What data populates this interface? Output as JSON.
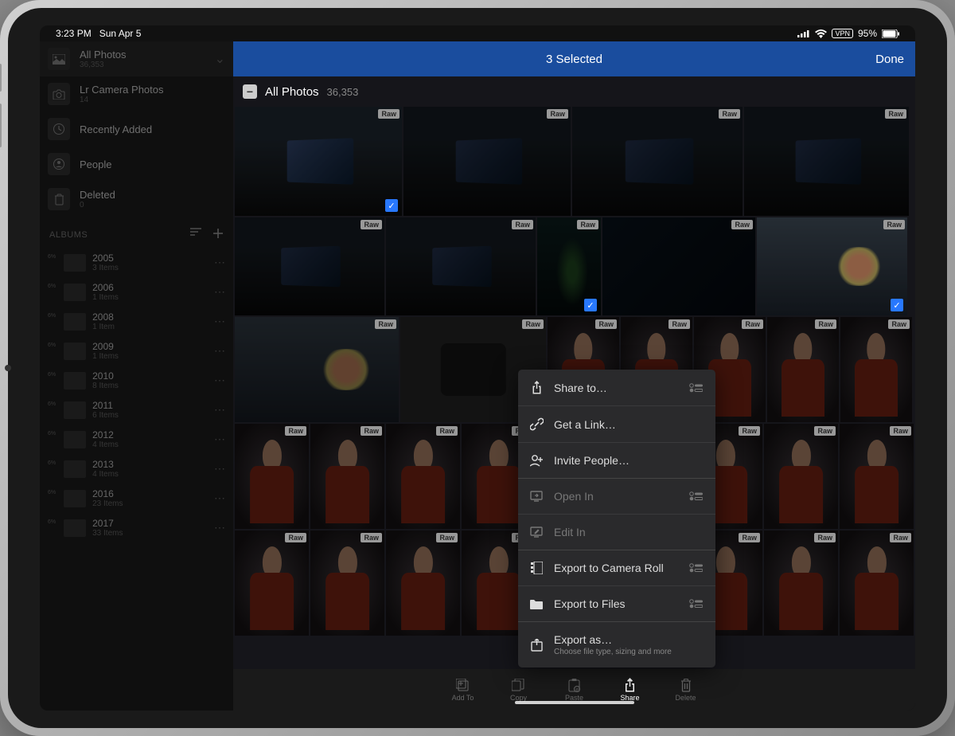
{
  "status": {
    "time": "3:23 PM",
    "date": "Sun Apr 5",
    "vpn": "VPN",
    "battery": "95%"
  },
  "sidebar": {
    "items": [
      {
        "title": "All Photos",
        "sub": "36,353",
        "active": true,
        "chevron": true
      },
      {
        "title": "Lr Camera Photos",
        "sub": "14"
      },
      {
        "title": "Recently Added",
        "sub": ""
      },
      {
        "title": "People",
        "sub": ""
      },
      {
        "title": "Deleted",
        "sub": "0"
      }
    ],
    "albums_label": "ALBUMS",
    "albums": [
      {
        "title": "2005",
        "sub": "3 Items"
      },
      {
        "title": "2006",
        "sub": "1 Items"
      },
      {
        "title": "2008",
        "sub": "1 Item"
      },
      {
        "title": "2009",
        "sub": "1 Items"
      },
      {
        "title": "2010",
        "sub": "8 Items"
      },
      {
        "title": "2011",
        "sub": "6 Items"
      },
      {
        "title": "2012",
        "sub": "4 Items"
      },
      {
        "title": "2013",
        "sub": "4 Items"
      },
      {
        "title": "2016",
        "sub": "23 Items"
      },
      {
        "title": "2017",
        "sub": "33 Items"
      }
    ]
  },
  "topbar": {
    "title": "3 Selected",
    "done": "Done"
  },
  "collection": {
    "title": "All Photos",
    "count": "36,353"
  },
  "raw": "Raw",
  "bottom": [
    {
      "label": "Add To",
      "active": false
    },
    {
      "label": "Copy",
      "active": false
    },
    {
      "label": "Paste",
      "active": false
    },
    {
      "label": "Share",
      "active": true
    },
    {
      "label": "Delete",
      "active": false
    }
  ],
  "menu": [
    {
      "label": "Share to…",
      "icon": "share-up",
      "toggle": true,
      "group_end": false
    },
    {
      "label": "Get a Link…",
      "icon": "link",
      "group_end": false
    },
    {
      "label": "Invite People…",
      "icon": "person-add",
      "group_end": true
    },
    {
      "label": "Open In",
      "icon": "open-in",
      "disabled": true,
      "toggle": true
    },
    {
      "label": "Edit In",
      "icon": "edit-in",
      "disabled": true,
      "group_end": true
    },
    {
      "label": "Export to Camera Roll",
      "icon": "camera-roll",
      "toggle": true
    },
    {
      "label": "Export to Files",
      "icon": "folder",
      "toggle": true,
      "group_end": true
    },
    {
      "label": "Export as…",
      "icon": "export",
      "sub": "Choose file type, sizing and more"
    }
  ]
}
